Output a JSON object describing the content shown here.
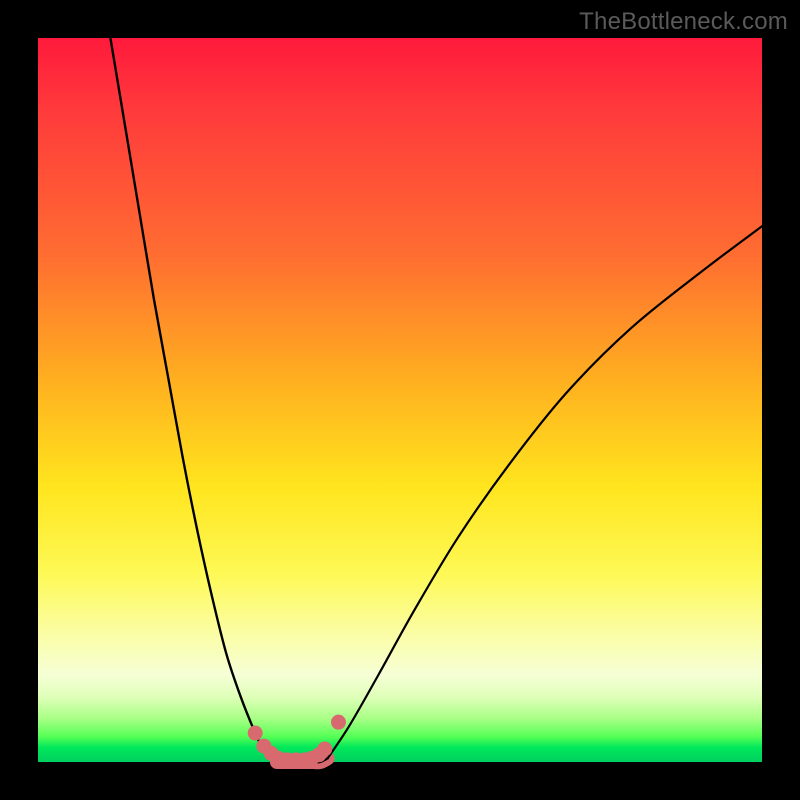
{
  "watermark": "TheBottleneck.com",
  "chart_data": {
    "type": "line",
    "title": "",
    "xlabel": "",
    "ylabel": "",
    "xlim": [
      0,
      100
    ],
    "ylim": [
      0,
      100
    ],
    "series": [
      {
        "name": "left-curve",
        "x": [
          10,
          12,
          14,
          16,
          18,
          20,
          22,
          24,
          26,
          28,
          30,
          31,
          32,
          33
        ],
        "values": [
          100,
          88,
          76,
          64,
          53,
          42,
          32,
          23,
          15,
          9,
          4,
          2,
          1,
          0
        ]
      },
      {
        "name": "valley-floor",
        "x": [
          33,
          34,
          35,
          36,
          37,
          38,
          39,
          40
        ],
        "values": [
          0,
          0,
          0,
          0,
          0,
          0,
          0,
          0.5
        ]
      },
      {
        "name": "right-curve",
        "x": [
          40,
          43,
          47,
          52,
          58,
          65,
          73,
          82,
          92,
          100
        ],
        "values": [
          0.5,
          5,
          12,
          21,
          31,
          41,
          51,
          60,
          68,
          74
        ]
      }
    ],
    "markers": {
      "name": "valley-beads",
      "color": "#d86a6f",
      "points_x": [
        30,
        31.2,
        32.2,
        33.2,
        34.4,
        35.6,
        36.8,
        37.8,
        38.8,
        39.6,
        41.5
      ],
      "points_y": [
        4.0,
        2.2,
        1.2,
        0.5,
        0.3,
        0.3,
        0.3,
        0.5,
        1.0,
        1.8,
        5.5
      ]
    }
  }
}
